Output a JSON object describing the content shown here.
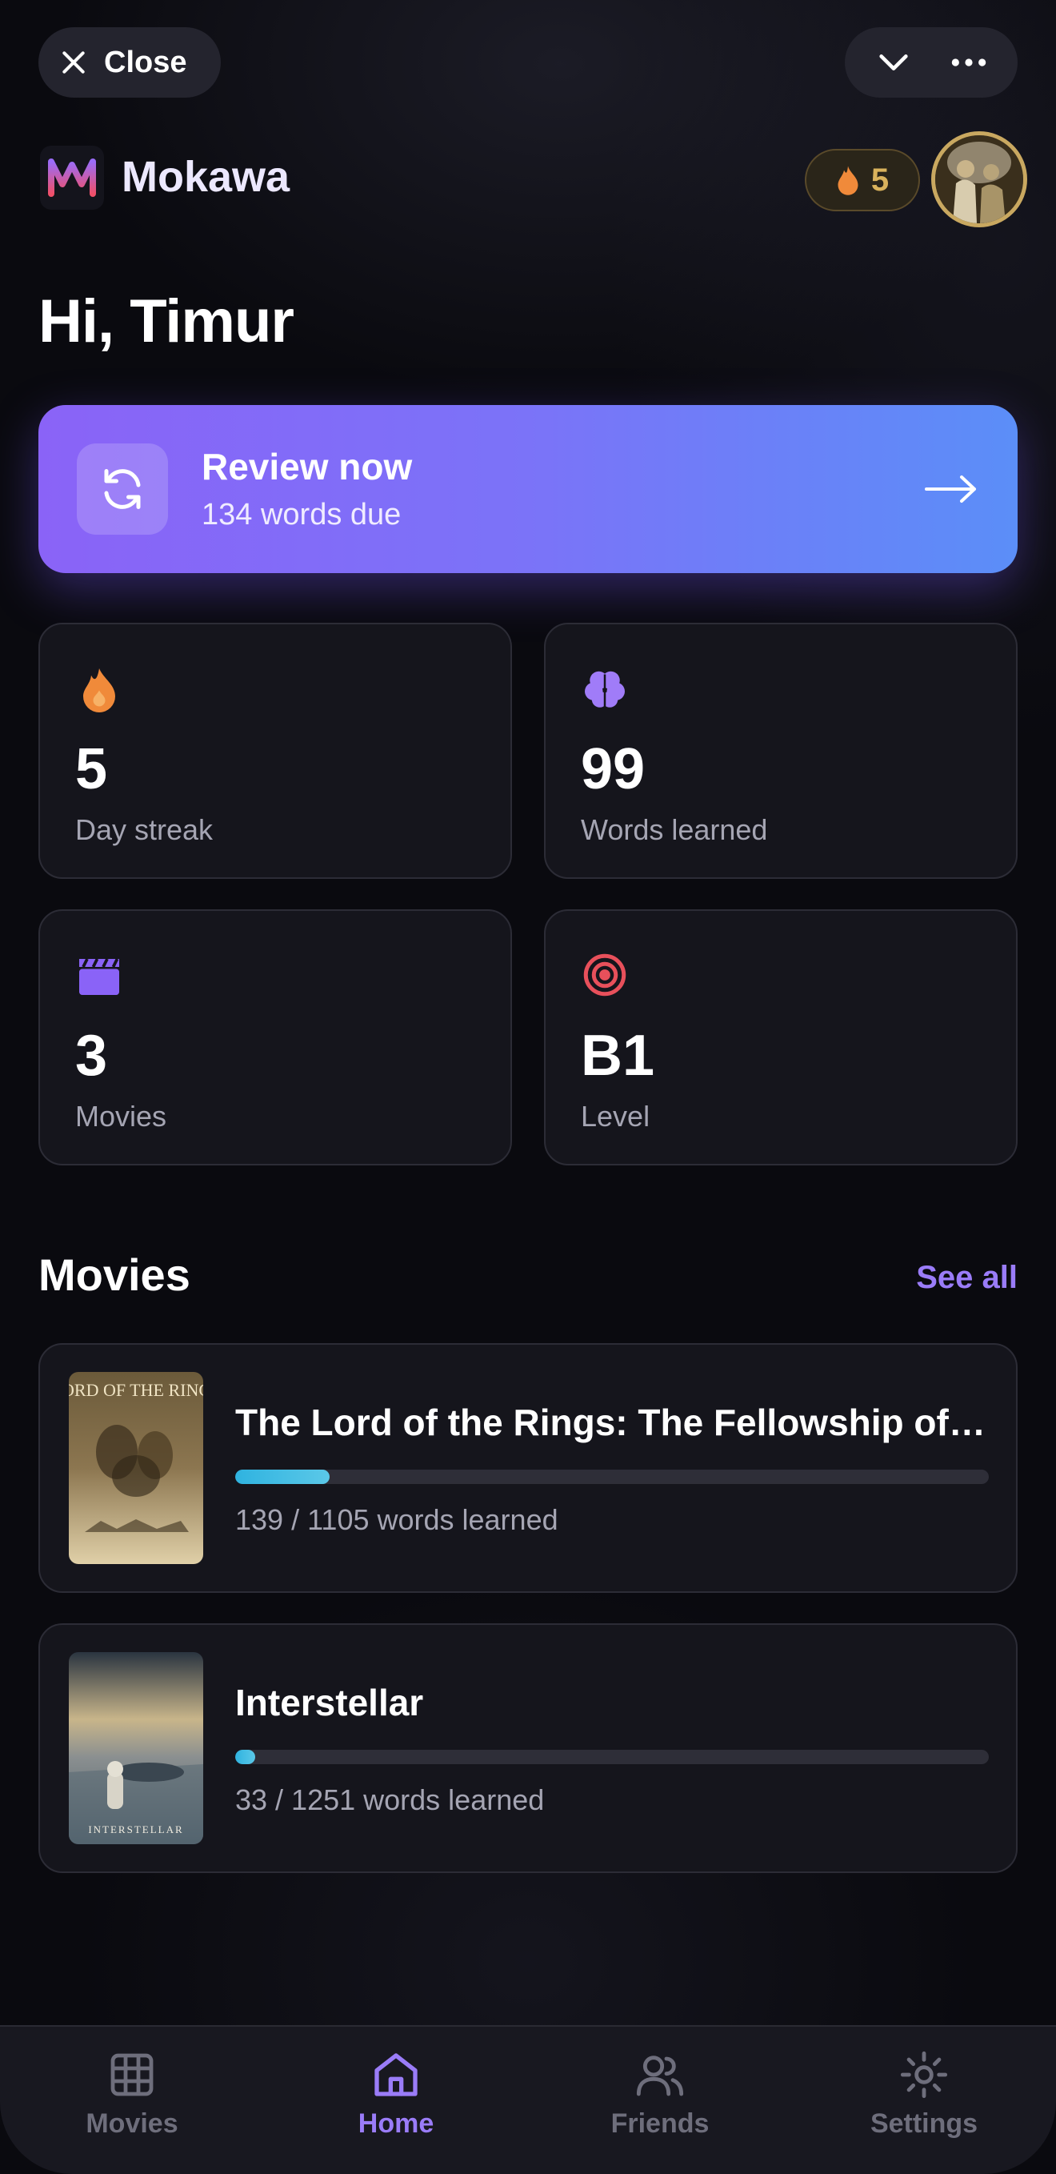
{
  "topbar": {
    "close_label": "Close",
    "close_icon": "x-icon",
    "collapse_icon": "chevron-down-icon",
    "more_icon": "more-horizontal-icon"
  },
  "header": {
    "app_name": "Mokawa",
    "logo_icon": "mokawa-logo-icon",
    "streak_count": "5",
    "greeting": "Hi, Timur"
  },
  "review": {
    "title": "Review now",
    "subtitle": "134 words due",
    "icon": "refresh-icon",
    "arrow_icon": "arrow-right-icon"
  },
  "stats": [
    {
      "value": "5",
      "label": "Day streak",
      "icon": "flame-icon",
      "color": "#f08a3a"
    },
    {
      "value": "99",
      "label": "Words learned",
      "icon": "brain-icon",
      "color": "#a07cf8"
    },
    {
      "value": "3",
      "label": "Movies",
      "icon": "clapperboard-icon",
      "color": "#8a63f7"
    },
    {
      "value": "B1",
      "label": "Level",
      "icon": "target-icon",
      "color": "#e8505b"
    }
  ],
  "movies_section": {
    "title": "Movies",
    "see_all": "See all",
    "items": [
      {
        "title": "The Lord of the Rings: The Fellowship of the Ring",
        "progress_text": "139 / 1105 words learned",
        "learned": 139,
        "total": 1105,
        "poster_text": "LORD OF THE RINGS"
      },
      {
        "title": "Interstellar",
        "progress_text": "33 / 1251 words learned",
        "learned": 33,
        "total": 1251,
        "poster_text": "INTERSTELLAR"
      }
    ]
  },
  "nav": [
    {
      "label": "Movies",
      "icon": "grid-icon",
      "active": false
    },
    {
      "label": "Home",
      "icon": "home-icon",
      "active": true
    },
    {
      "label": "Friends",
      "icon": "users-icon",
      "active": false
    },
    {
      "label": "Settings",
      "icon": "gear-icon",
      "active": false
    }
  ],
  "colors": {
    "accent": "#9a7cf8",
    "background": "#0a0a0f",
    "card": "#15151c",
    "progress": "#2fb3e0",
    "streak_gold": "#d9b25c"
  }
}
